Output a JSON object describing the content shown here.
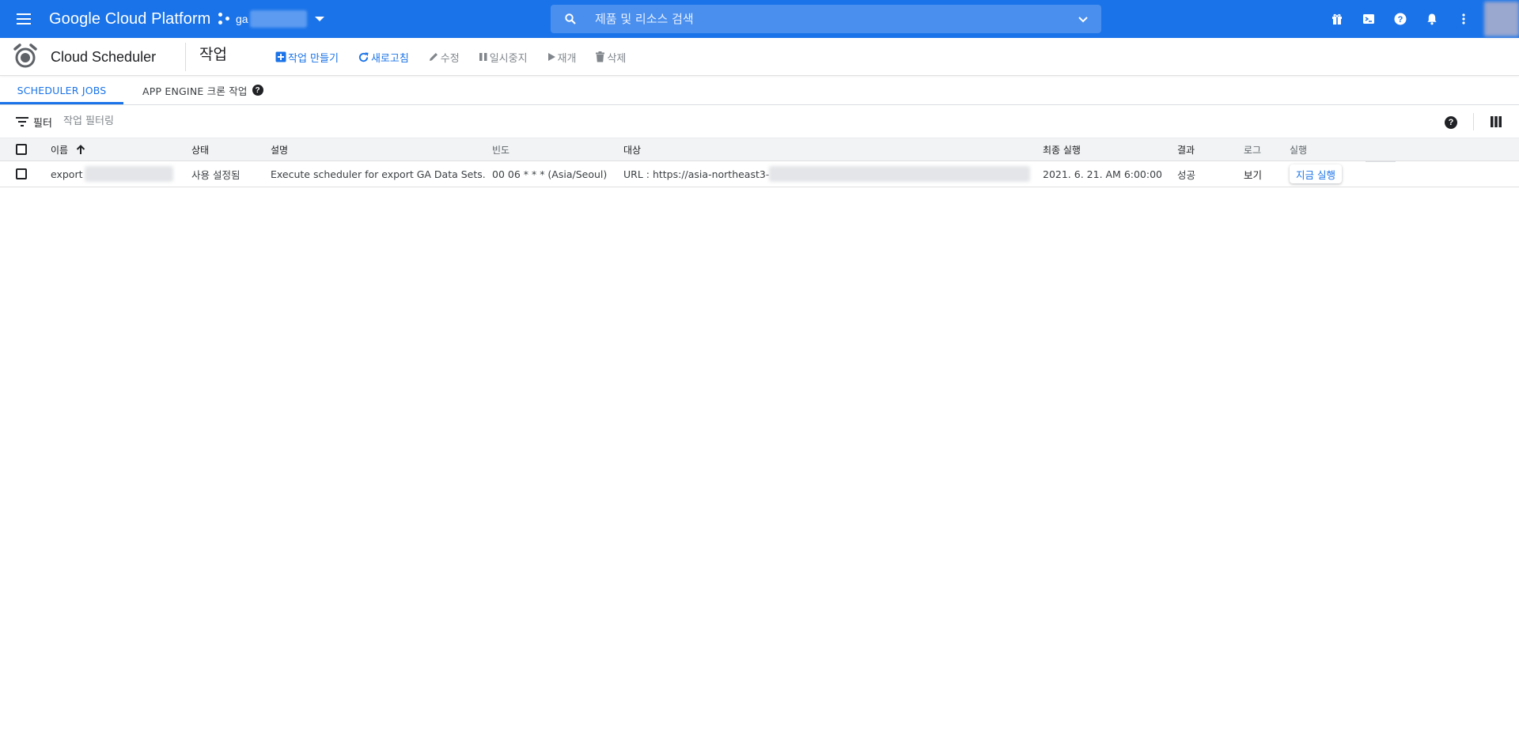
{
  "app": {
    "title": "Google Cloud Platform",
    "project_prefix": "ga",
    "search_placeholder": "제품 및 리소스 검색"
  },
  "top_icons": [
    "gift-icon",
    "cloud-shell-icon",
    "help-icon",
    "notifications-icon",
    "more-vert-icon"
  ],
  "colors": {
    "brand_blue": "#1a73e8",
    "text": "#202124",
    "muted": "#80868b",
    "header_bg": "#f1f3f4"
  },
  "subheader": {
    "product": "Cloud Scheduler",
    "page_title": "작업",
    "actions": {
      "create": "작업 만들기",
      "refresh": "새로고침",
      "edit": "수정",
      "pause": "일시중지",
      "resume": "재개",
      "delete": "삭제"
    }
  },
  "tabs": {
    "scheduler_jobs": "SCHEDULER JOBS",
    "app_engine_cron": "APP ENGINE 크론 작업"
  },
  "filter": {
    "label": "필터",
    "placeholder": "작업 필터링"
  },
  "table": {
    "columns": {
      "name": "이름",
      "status": "상태",
      "description": "설명",
      "frequency": "빈도",
      "target": "대상",
      "last_run": "최종 실행",
      "result": "결과",
      "log": "로그",
      "run": "실행"
    },
    "rows": [
      {
        "name": "export",
        "status": "사용 설정됨",
        "description": "Execute scheduler for export GA Data Sets.",
        "frequency": "00 06 * * * (Asia/Seoul)",
        "target": "URL : https://asia-northeast3-",
        "last_run": "2021. 6. 21. AM 6:00:00",
        "result": "성공",
        "log": "보기",
        "run": "지금 실행"
      }
    ]
  }
}
